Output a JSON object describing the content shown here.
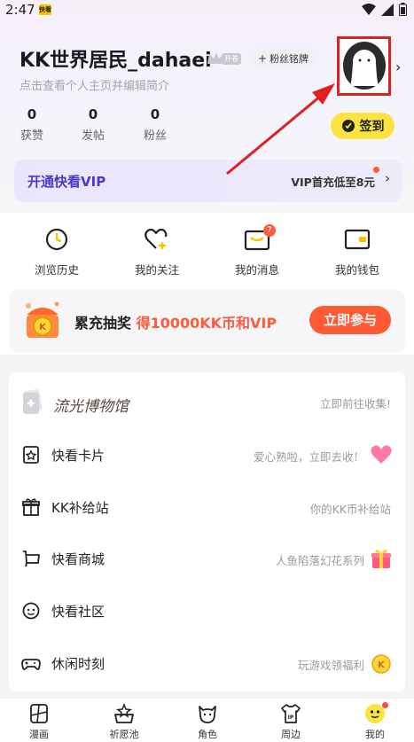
{
  "status_bar": {
    "time": "2:47",
    "app_badge": "快看"
  },
  "profile": {
    "username": "KK世界居民_dahaei",
    "level_badge": "开卷",
    "fan_badge": "粉丝铭牌",
    "fan_badge_plus": "+",
    "subtitle": "点击查看个人主页并编辑简介",
    "stats": [
      {
        "value": "0",
        "label": "获赞"
      },
      {
        "value": "0",
        "label": "发帖"
      },
      {
        "value": "0",
        "label": "粉丝"
      }
    ],
    "signin_label": "签到"
  },
  "vip": {
    "title": "开通快看VIP",
    "promo": "VIP首充低至8元"
  },
  "quick_actions": [
    {
      "label": "浏览历史",
      "icon": "clock-icon"
    },
    {
      "label": "我的关注",
      "icon": "heart-plus-icon"
    },
    {
      "label": "我的消息",
      "icon": "message-icon",
      "badge": "7"
    },
    {
      "label": "我的钱包",
      "icon": "wallet-icon"
    }
  ],
  "lottery": {
    "text_prefix": "累充抽奖 ",
    "text_highlight": "得10000KK币和VIP",
    "button": "立即参与"
  },
  "menu": {
    "museum_title": "流光博物馆",
    "museum_hint": "立即前往收集!",
    "items": [
      {
        "label": "快看卡片",
        "hint": "爱心熟啦，立即去收！",
        "icon": "card-icon"
      },
      {
        "label": "KK补给站",
        "hint": "你的KK币补给站",
        "icon": "gift-box-icon"
      },
      {
        "label": "快看商城",
        "hint": "人鱼陷落幻花系列",
        "icon": "cart-icon"
      },
      {
        "label": "快看社区",
        "hint": "",
        "icon": "community-icon"
      },
      {
        "label": "休闲时刻",
        "hint": "玩游戏领福利",
        "icon": "gamepad-icon"
      }
    ]
  },
  "bottom_nav": [
    {
      "label": "漫画",
      "icon": "comic-icon"
    },
    {
      "label": "祈愿池",
      "icon": "wish-pool-icon"
    },
    {
      "label": "角色",
      "icon": "character-icon"
    },
    {
      "label": "周边",
      "icon": "merch-icon"
    },
    {
      "label": "我的",
      "icon": "profile-face-icon"
    }
  ],
  "colors": {
    "accent_yellow": "#fce33f",
    "vip_purple": "#4a3acb",
    "cta_orange": "#ff5a33",
    "annotation_red": "#e02020"
  }
}
